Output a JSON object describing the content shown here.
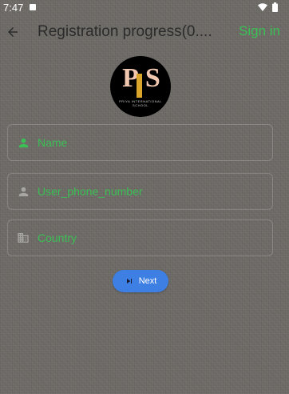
{
  "status_bar": {
    "time": "7:47"
  },
  "app_bar": {
    "title": "Registration progress(0....",
    "sign_in_label": "Sign in"
  },
  "logo": {
    "letters_p": "P",
    "letters_s": "S",
    "tagline": "PRIYA INTERNATIONAL SCHOOL"
  },
  "form": {
    "name_placeholder": "Name",
    "phone_placeholder": "User_phone_number",
    "country_placeholder": "Country"
  },
  "next_button": {
    "label": "Next"
  },
  "colors": {
    "accent_green": "#3bbf55",
    "button_blue": "#3d7fe3",
    "background": "#6d6a66"
  },
  "icons": {
    "back": "arrow-back-icon",
    "name": "person-icon",
    "phone": "person-icon",
    "country": "building-icon",
    "next": "skip-next-icon"
  }
}
